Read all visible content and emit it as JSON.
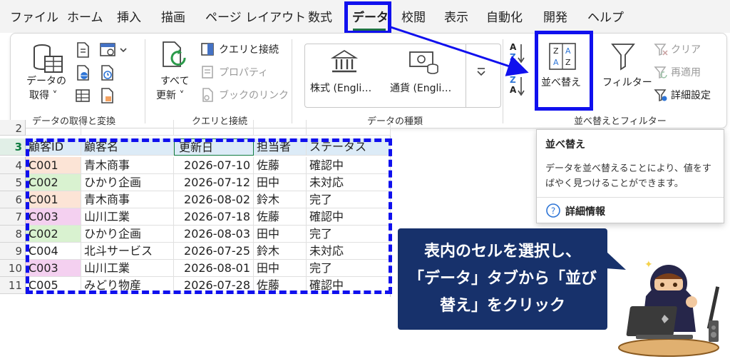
{
  "tabs": [
    "ファイル",
    "ホーム",
    "挿入",
    "描画",
    "ページ レイアウト",
    "数式",
    "データ",
    "校閲",
    "表示",
    "自動化",
    "開発",
    "ヘルプ"
  ],
  "ribbon": {
    "get_data": {
      "label_line1": "データの",
      "label_line2": "取得 ˅",
      "group": "データの取得と変換"
    },
    "queries": {
      "refresh_line1": "すべて",
      "refresh_line2": "更新 ˅",
      "queries_connections": "クエリと接続",
      "properties": "プロパティ",
      "edit_links": "ブックのリンク",
      "group": "クエリと接続"
    },
    "data_types": {
      "stocks": "株式 (Engli…",
      "currencies": "通貨 (Engli…",
      "group": "データの種類"
    },
    "sort_filter": {
      "az_top": "A",
      "az_bottom": "Z",
      "za_top": "Z",
      "za_bottom": "A",
      "sort": "並べ替え",
      "filter": "フィルター",
      "clear": "クリア",
      "reapply": "再適用",
      "advanced": "詳細設定",
      "group": "並べ替えとフィルター"
    }
  },
  "grid": {
    "rows": [
      {
        "num": "2",
        "cells": [
          "",
          "",
          "",
          "",
          ""
        ]
      },
      {
        "num": "3",
        "cells": [
          "顧客ID",
          "顧客名",
          "更新日",
          "担当者",
          "ステータス"
        ]
      },
      {
        "num": "4",
        "cells": [
          "C001",
          "青木商事",
          "2026-07-10",
          "佐藤",
          "確認中"
        ]
      },
      {
        "num": "5",
        "cells": [
          "C002",
          "ひかり企画",
          "2026-07-12",
          "田中",
          "未対応"
        ]
      },
      {
        "num": "6",
        "cells": [
          "C001",
          "青木商事",
          "2026-08-02",
          "鈴木",
          "完了"
        ]
      },
      {
        "num": "7",
        "cells": [
          "C003",
          "山川工業",
          "2026-07-18",
          "佐藤",
          "確認中"
        ]
      },
      {
        "num": "8",
        "cells": [
          "C002",
          "ひかり企画",
          "2026-08-03",
          "田中",
          "完了"
        ]
      },
      {
        "num": "9",
        "cells": [
          "C004",
          "北斗サービス",
          "2026-07-25",
          "鈴木",
          "未対応"
        ]
      },
      {
        "num": "10",
        "cells": [
          "C003",
          "山川工業",
          "2026-08-01",
          "田中",
          "完了"
        ]
      },
      {
        "num": "11",
        "cells": [
          "C005",
          "みどり物産",
          "2026-07-28",
          "佐藤",
          "確認中"
        ]
      }
    ],
    "id_colors": {
      "C001": "#fce4d6",
      "C002": "#d9f2d0",
      "C003": "#f4d0f0",
      "C004": "#ffffff",
      "C005": "#ffffff"
    },
    "header_color": "#dcebf7"
  },
  "tooltip": {
    "title": "並べ替え",
    "body": "データを並べ替えることにより、値をすばやく見つけることができます。",
    "help_icon": "?",
    "help": "詳細情報"
  },
  "callout": {
    "line1": "表内のセルを選択し、",
    "line2": "「データ」タブから「並び",
    "line3": "替え」をクリック"
  },
  "colors": {
    "highlight": "#1010ee",
    "callout_bg": "#17316b",
    "excel_green": "#107c41"
  }
}
